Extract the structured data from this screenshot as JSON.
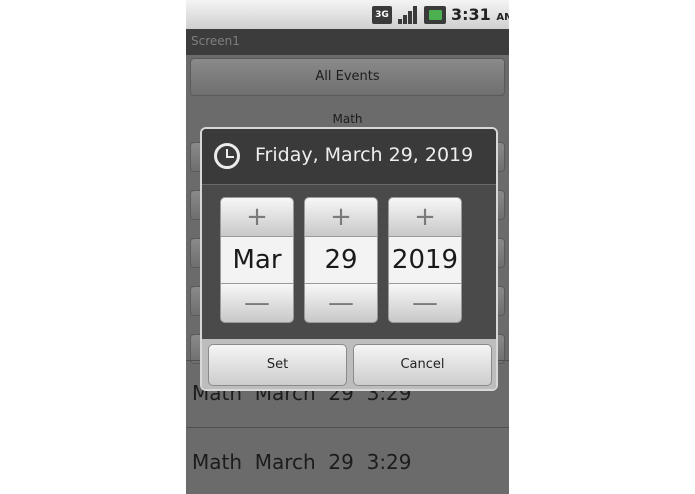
{
  "status_bar": {
    "network": "3G",
    "time": "3:31",
    "ampm": "AM",
    "icons": [
      "3g-icon",
      "signal-icon",
      "battery-icon"
    ]
  },
  "app": {
    "title": "Screen1",
    "all_events_label": "All Events",
    "section_label": "Math",
    "list_items": [
      "Math  March  29  3:29",
      "Math  March  29  3:29"
    ]
  },
  "dialog": {
    "title": "Friday, March 29, 2019",
    "icon": "clock-icon",
    "month": "Mar",
    "day": "29",
    "year": "2019",
    "increment_symbol": "+",
    "decrement_symbol": "—",
    "set_label": "Set",
    "cancel_label": "Cancel"
  }
}
